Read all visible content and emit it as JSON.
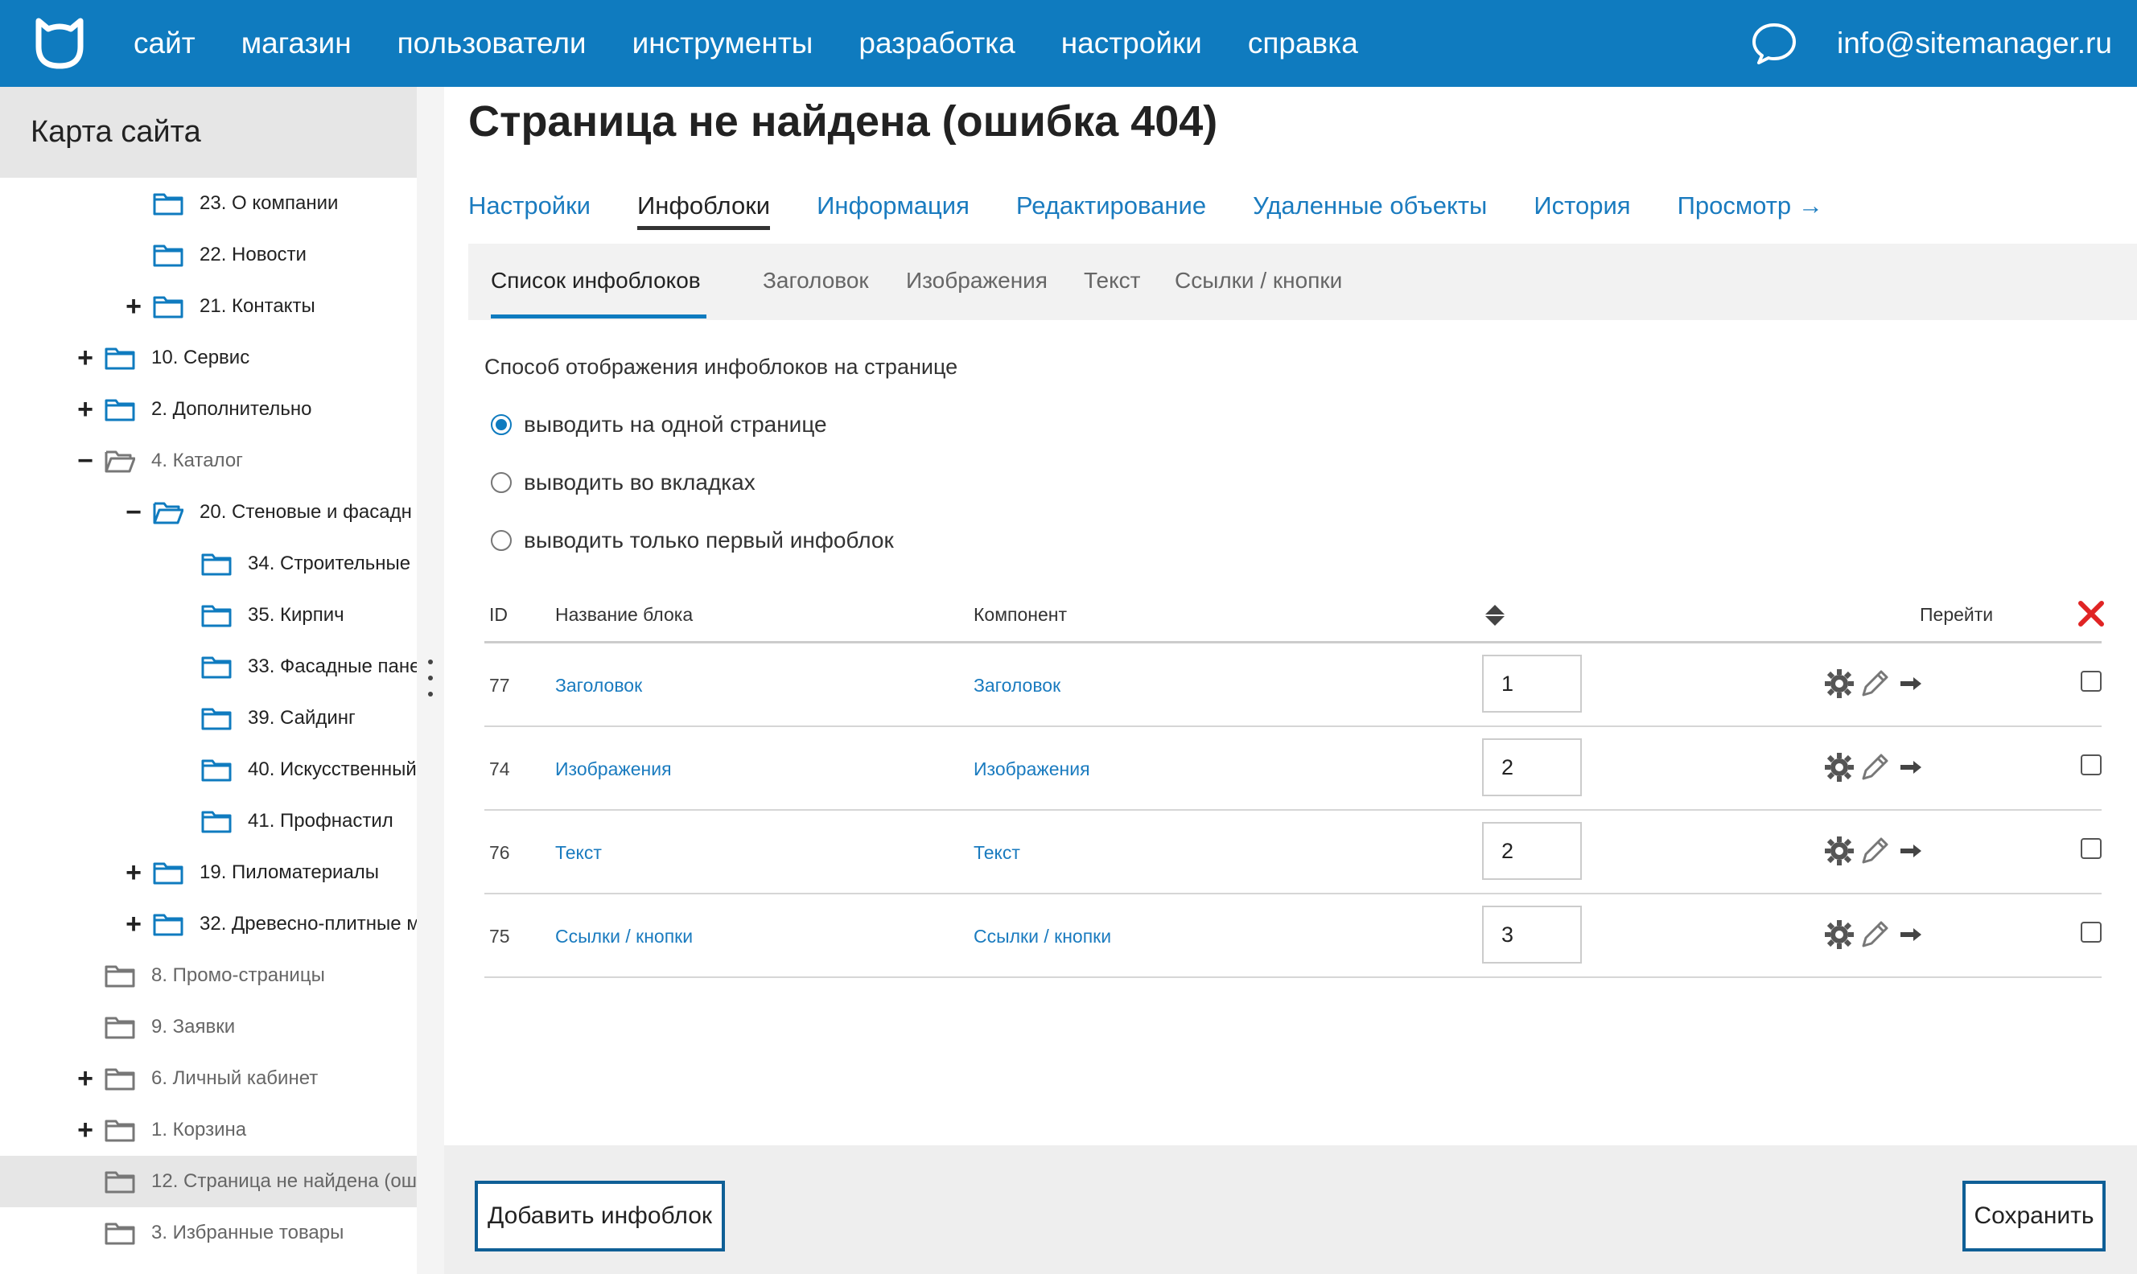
{
  "topbar": {
    "nav": [
      "сайт",
      "магазин",
      "пользователи",
      "инструменты",
      "разработка",
      "настройки",
      "справка"
    ],
    "email": "info@sitemanager.ru"
  },
  "sidebar": {
    "title": "Карта сайта",
    "items": [
      {
        "label": "23. О компании",
        "level": 2,
        "toggle": ""
      },
      {
        "label": "22. Новости",
        "level": 2,
        "toggle": ""
      },
      {
        "label": "21. Контакты",
        "level": 2,
        "toggle": "+"
      },
      {
        "label": "10. Сервис",
        "level": 1,
        "toggle": "+"
      },
      {
        "label": "2. Дополнительно",
        "level": 1,
        "toggle": "+"
      },
      {
        "label": "4. Каталог",
        "level": 1,
        "toggle": "−",
        "open": true,
        "muted": true
      },
      {
        "label": "20. Стеновые и фасадн",
        "level": 2,
        "toggle": "−",
        "open": true
      },
      {
        "label": "34. Строительные",
        "level": 3,
        "toggle": ""
      },
      {
        "label": "35. Кирпич",
        "level": 3,
        "toggle": ""
      },
      {
        "label": "33. Фасадные пане",
        "level": 3,
        "toggle": ""
      },
      {
        "label": "39. Сайдинг",
        "level": 3,
        "toggle": ""
      },
      {
        "label": "40. Искусственный",
        "level": 3,
        "toggle": ""
      },
      {
        "label": "41. Профнастил",
        "level": 3,
        "toggle": ""
      },
      {
        "label": "19. Пиломатериалы",
        "level": 2,
        "toggle": "+"
      },
      {
        "label": "32. Древесно-плитные м",
        "level": 2,
        "toggle": "+"
      },
      {
        "label": "8. Промо-страницы",
        "level": 1,
        "toggle": "",
        "muted": true
      },
      {
        "label": "9. Заявки",
        "level": 1,
        "toggle": "",
        "muted": true
      },
      {
        "label": "6. Личный кабинет",
        "level": 1,
        "toggle": "+",
        "muted": true
      },
      {
        "label": "1. Корзина",
        "level": 1,
        "toggle": "+",
        "muted": true
      },
      {
        "label": "12. Страница не найдена (ош",
        "level": 1,
        "toggle": "",
        "muted": true,
        "active": true
      },
      {
        "label": "3. Избранные товары",
        "level": 1,
        "toggle": "",
        "muted": true
      }
    ]
  },
  "main": {
    "title": "Страница не найдена (ошибка 404)",
    "tabs": [
      {
        "label": "Настройки",
        "active": false
      },
      {
        "label": "Инфоблоки",
        "active": true
      },
      {
        "label": "Информация",
        "active": false
      },
      {
        "label": "Редактирование",
        "active": false
      },
      {
        "label": "Удаленные объекты",
        "active": false
      },
      {
        "label": "История",
        "active": false
      },
      {
        "label": "Просмотр →",
        "active": false
      }
    ],
    "subtabs": [
      {
        "label": "Список инфоблоков",
        "active": true
      },
      {
        "label": "Заголовок",
        "active": false
      },
      {
        "label": "Изображения",
        "active": false
      },
      {
        "label": "Текст",
        "active": false
      },
      {
        "label": "Ссылки / кнопки",
        "active": false
      }
    ],
    "display_label": "Способ отображения инфоблоков на странице",
    "display_options": [
      {
        "label": "выводить на одной странице",
        "checked": true
      },
      {
        "label": "выводить во вкладках",
        "checked": false
      },
      {
        "label": "выводить только первый инфоблок",
        "checked": false
      }
    ],
    "table": {
      "headers": {
        "id": "ID",
        "name": "Название блока",
        "component": "Компонент",
        "go": "Перейти"
      },
      "rows": [
        {
          "id": "77",
          "name": "Заголовок",
          "component": "Заголовок",
          "order": "1",
          "checked": false
        },
        {
          "id": "74",
          "name": "Изображения",
          "component": "Изображения",
          "order": "2",
          "checked": false
        },
        {
          "id": "76",
          "name": "Текст",
          "component": "Текст",
          "order": "2",
          "checked": false
        },
        {
          "id": "75",
          "name": "Ссылки / кнопки",
          "component": "Ссылки / кнопки",
          "order": "3",
          "checked": false
        }
      ]
    },
    "footer": {
      "add_label": "Добавить инфоблок",
      "save_label": "Сохранить"
    }
  },
  "colors": {
    "brand": "#0f7bbf",
    "link": "#1a7bbf",
    "delete": "#e02424"
  },
  "icons": [
    "logo-icon",
    "chat-icon",
    "folder-icon",
    "folder-open-icon",
    "sort-icon",
    "delete-x-icon",
    "gear-icon",
    "pencil-icon",
    "arrow-right-icon"
  ]
}
